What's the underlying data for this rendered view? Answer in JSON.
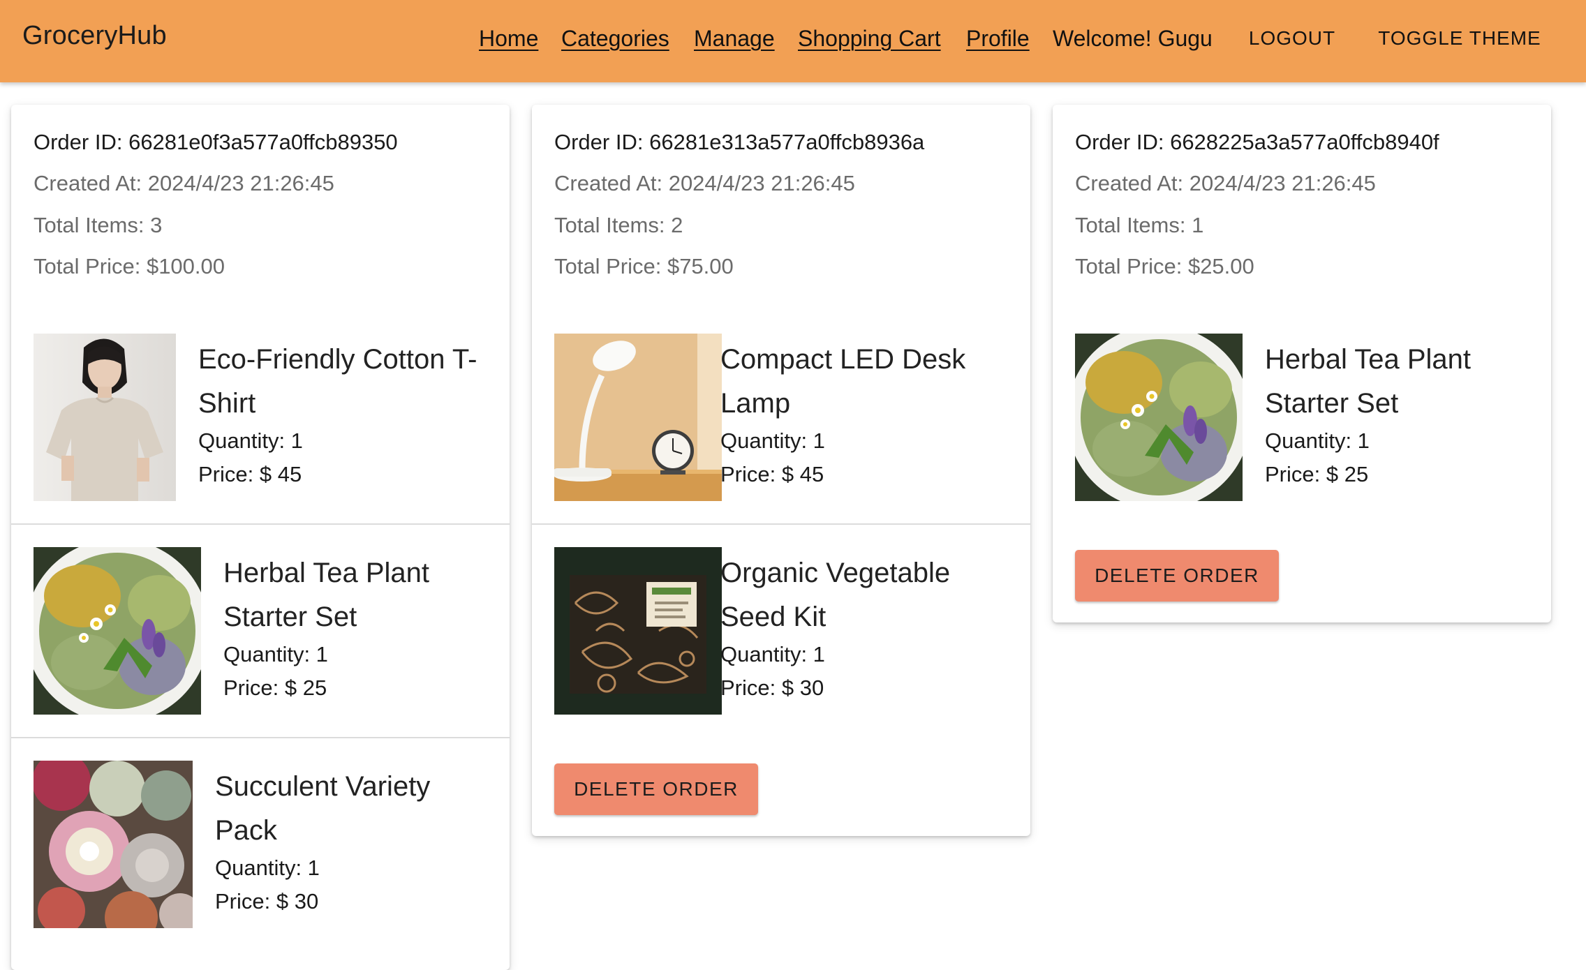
{
  "header": {
    "brand": "GroceryHub",
    "nav": {
      "home": "Home",
      "categories": "Categories",
      "manage": "Manage",
      "cart": "Shopping Cart",
      "profile": "Profile"
    },
    "welcome": "Welcome! Gugu",
    "logout": "LOGOUT",
    "toggle_theme": "TOGGLE THEME"
  },
  "colors": {
    "appbar": "#f2a054",
    "delete_button": "#ef8a6e",
    "muted_text": "#6b6b6b"
  },
  "orders": [
    {
      "id": "Order ID: 66281e0f3a577a0ffcb89350",
      "created": "Created At: 2024/4/23 21:26:45",
      "total_items": "Total Items: 3",
      "total_price": "Total Price: $100.00",
      "items": [
        {
          "name": "Eco-Friendly Cotton T-Shirt",
          "quantity": "Quantity: 1",
          "price": "Price: $ 45",
          "image": "tshirt-photo"
        },
        {
          "name": "Herbal Tea Plant Starter Set",
          "quantity": "Quantity: 1",
          "price": "Price: $ 25",
          "image": "herbal-tea-photo"
        },
        {
          "name": "Succulent Variety Pack",
          "quantity": "Quantity: 1",
          "price": "Price: $ 30",
          "image": "succulent-photo"
        }
      ]
    },
    {
      "id": "Order ID: 66281e313a577a0ffcb8936a",
      "created": "Created At: 2024/4/23 21:26:45",
      "total_items": "Total Items: 2",
      "total_price": "Total Price: $75.00",
      "items": [
        {
          "name": "Compact LED Desk Lamp",
          "quantity": "Quantity: 1",
          "price": "Price: $ 45",
          "image": "desk-lamp-photo"
        },
        {
          "name": "Organic Vegetable Seed Kit",
          "quantity": "Quantity: 1",
          "price": "Price: $ 30",
          "image": "seed-kit-photo"
        }
      ],
      "delete_label": "DELETE ORDER"
    },
    {
      "id": "Order ID: 6628225a3a577a0ffcb8940f",
      "created": "Created At: 2024/4/23 21:26:45",
      "total_items": "Total Items: 1",
      "total_price": "Total Price: $25.00",
      "items": [
        {
          "name": "Herbal Tea Plant Starter Set",
          "quantity": "Quantity: 1",
          "price": "Price: $ 25",
          "image": "herbal-tea-photo"
        }
      ],
      "delete_label": "DELETE ORDER"
    }
  ]
}
